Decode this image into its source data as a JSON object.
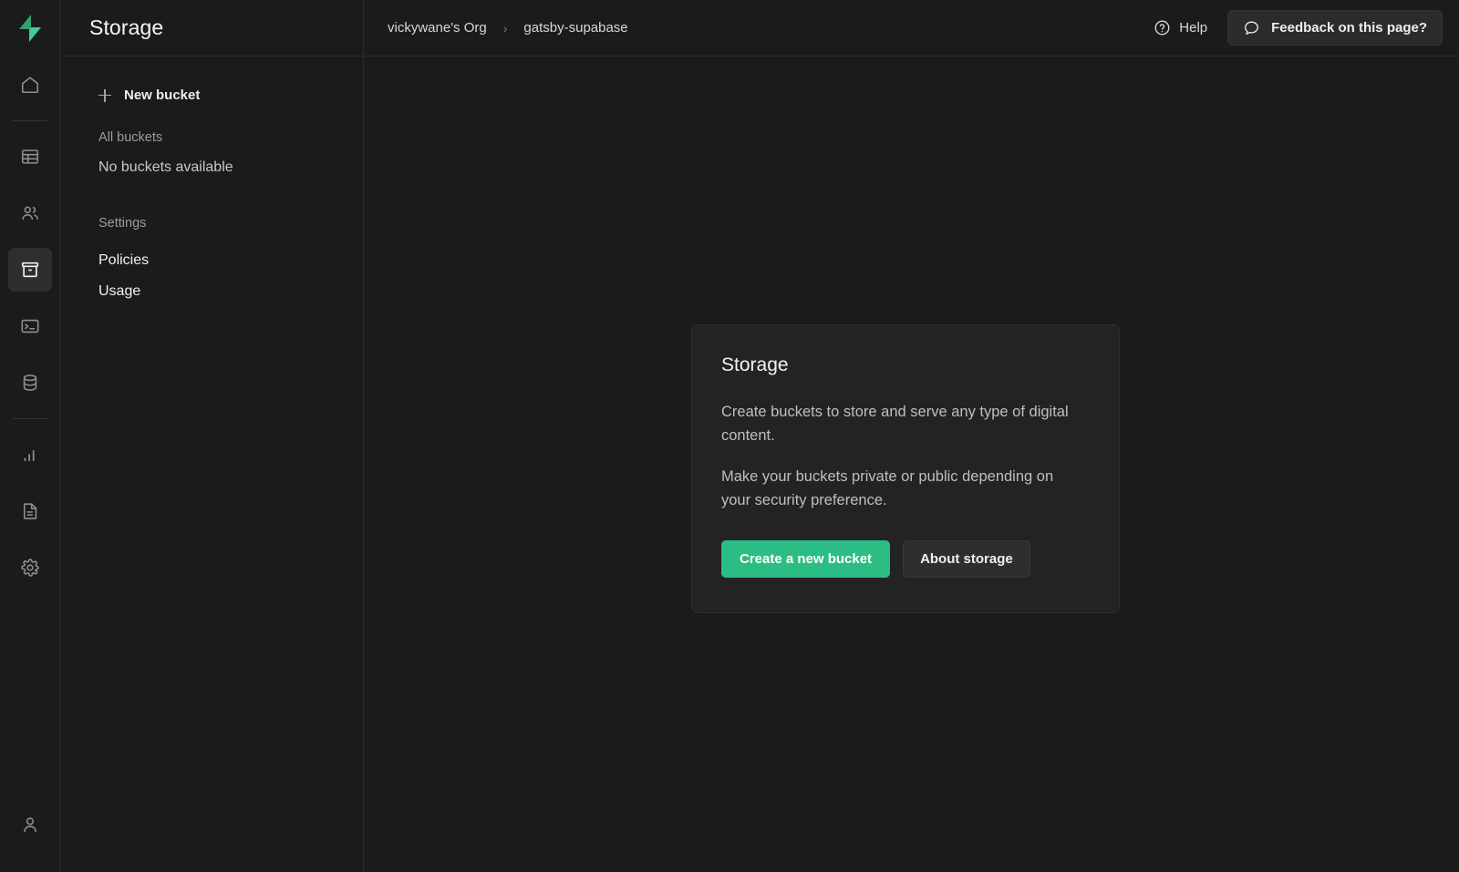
{
  "brand": {
    "logo_icon": "supabase-logo-icon",
    "logo_color_dark": "#3ecf8e",
    "logo_color_light": "#4ade9b"
  },
  "rail": {
    "items": [
      {
        "icon": "home-icon",
        "name": "home",
        "active": false
      },
      {
        "icon": "table-editor-icon",
        "name": "table-editor",
        "active": false
      },
      {
        "icon": "authentication-users-icon",
        "name": "authentication",
        "active": false
      },
      {
        "icon": "storage-archive-icon",
        "name": "storage",
        "active": true
      },
      {
        "icon": "sql-editor-terminal-icon",
        "name": "sql-editor",
        "active": false
      },
      {
        "icon": "database-icon",
        "name": "database",
        "active": false
      },
      {
        "icon": "reports-bar-chart-icon",
        "name": "reports",
        "active": false
      },
      {
        "icon": "logs-document-icon",
        "name": "logs",
        "active": false
      },
      {
        "icon": "settings-gear-icon",
        "name": "settings",
        "active": false
      }
    ],
    "account_icon": "user-account-icon"
  },
  "nav": {
    "title": "Storage",
    "new_bucket_label": "New bucket",
    "new_bucket_icon": "plus-icon",
    "all_buckets_label": "All buckets",
    "no_buckets_label": "No buckets available",
    "settings_label": "Settings",
    "policies_label": "Policies",
    "usage_label": "Usage"
  },
  "topbar": {
    "breadcrumb": {
      "org": "vickywane's Org",
      "separator": "›",
      "project": "gatsby-supabase"
    },
    "help_label": "Help",
    "help_icon": "question-circle-icon",
    "feedback_label": "Feedback on this page?",
    "feedback_icon": "speech-bubble-icon"
  },
  "card": {
    "title": "Storage",
    "paragraph_1": "Create buckets to store and serve any type of digital content.",
    "paragraph_2": "Make your buckets private or public depending on your security preference.",
    "primary_button": "Create a new bucket",
    "secondary_button": "About storage",
    "primary_color": "#2bbd84"
  }
}
